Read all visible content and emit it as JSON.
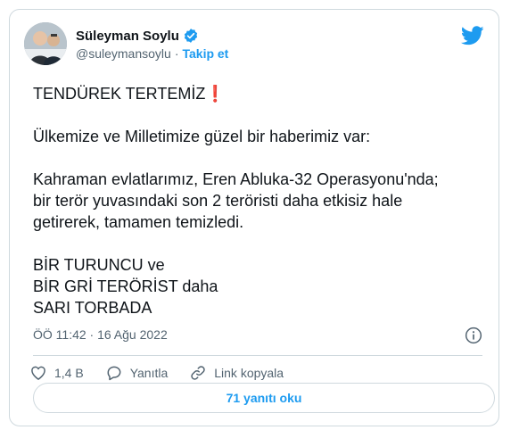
{
  "tweet": {
    "author_name": "Süleyman Soylu",
    "handle": "@suleymansoylu",
    "separator": "·",
    "follow_label": "Takip et",
    "headline": "TENDÜREK TERTEMİZ",
    "headline_emoji": "❗",
    "body": "Ülkemize ve Milletimize güzel bir haberimiz var:\n\nKahraman evlatlarımız, Eren Abluka-32 Operasyonu'nda;\nbir terör yuvasındaki son 2 teröristi daha etkisiz hale\ngetirerek, tamamen temizledi.\n\nBİR TURUNCU ve\nBİR GRİ TERÖRİST daha\nSARI TORBADA",
    "timestamp": "ÖÖ 11:42 · 16 Ağu 2022",
    "likes": "1,4 B",
    "reply_label": "Yanıtla",
    "copy_link_label": "Link kopyala",
    "read_replies_label": "71 yanıtı oku"
  },
  "icons": {
    "verified": "verified-badge-icon",
    "logo": "twitter-bird-icon",
    "info": "info-icon",
    "like": "heart-icon",
    "reply": "speech-bubble-icon",
    "link": "link-icon"
  },
  "colors": {
    "accent": "#1d9bf0",
    "text": "#0f1419",
    "muted": "#536471",
    "border": "#cfd9de"
  }
}
